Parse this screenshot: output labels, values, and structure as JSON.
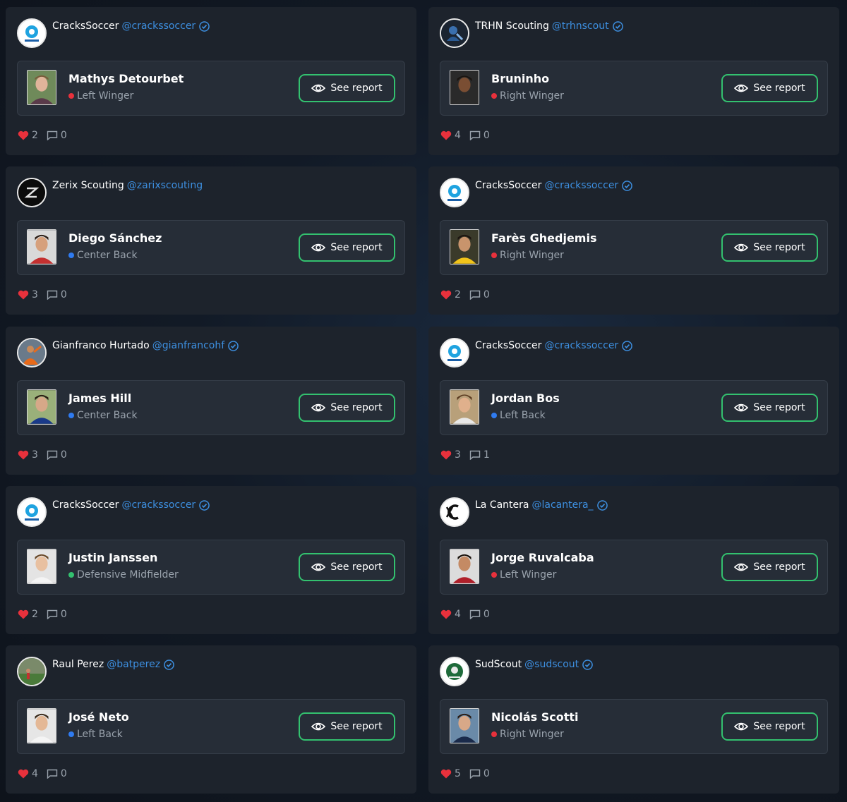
{
  "ui": {
    "see_report_label": "See report",
    "colors": {
      "card_bg": "#1d232c",
      "player_box_bg": "#262d37",
      "button_border": "#33c16f",
      "handle": "#3d8fe0",
      "verified": "#3d8fe0",
      "heart": "#e8313c",
      "pos_winger": "#e8313c",
      "pos_defender": "#2f7bf0",
      "pos_midfielder": "#33c16f"
    },
    "icons": [
      "verified-badge-icon",
      "eye-icon",
      "heart-icon",
      "comment-icon"
    ]
  },
  "cards": [
    {
      "author_name": "CracksSoccer",
      "author_handle": "@crackssoccer",
      "verified": true,
      "avatar": "crackssoccer-logo",
      "player_name": "Mathys Detourbet",
      "position": "Left Winger",
      "position_color": "#e8313c",
      "likes": "2",
      "comments": "0"
    },
    {
      "author_name": "TRHN Scouting",
      "author_handle": "@trhnscout",
      "verified": true,
      "avatar": "trhn-logo",
      "player_name": "Bruninho",
      "position": "Right Winger",
      "position_color": "#e8313c",
      "likes": "4",
      "comments": "0"
    },
    {
      "author_name": "Zerix Scouting",
      "author_handle": "@zarixscouting",
      "verified": false,
      "avatar": "zerix-logo",
      "player_name": "Diego Sánchez",
      "position": "Center Back",
      "position_color": "#2f7bf0",
      "likes": "3",
      "comments": "0"
    },
    {
      "author_name": "CracksSoccer",
      "author_handle": "@crackssoccer",
      "verified": true,
      "avatar": "crackssoccer-logo",
      "player_name": "Farès Ghedjemis",
      "position": "Right Winger",
      "position_color": "#e8313c",
      "likes": "2",
      "comments": "0"
    },
    {
      "author_name": "Gianfranco Hurtado",
      "author_handle": "@gianfrancohf",
      "verified": true,
      "avatar": "person-photo",
      "player_name": "James Hill",
      "position": "Center Back",
      "position_color": "#2f7bf0",
      "likes": "3",
      "comments": "0"
    },
    {
      "author_name": "CracksSoccer",
      "author_handle": "@crackssoccer",
      "verified": true,
      "avatar": "crackssoccer-logo",
      "player_name": "Jordan Bos",
      "position": "Left Back",
      "position_color": "#2f7bf0",
      "likes": "3",
      "comments": "1"
    },
    {
      "author_name": "CracksSoccer",
      "author_handle": "@crackssoccer",
      "verified": true,
      "avatar": "crackssoccer-logo",
      "player_name": "Justin Janssen",
      "position": "Defensive Midfielder",
      "position_color": "#33c16f",
      "likes": "2",
      "comments": "0"
    },
    {
      "author_name": "La Cantera",
      "author_handle": "@lacantera_",
      "verified": true,
      "avatar": "lacantera-logo",
      "player_name": "Jorge Ruvalcaba",
      "position": "Left Winger",
      "position_color": "#e8313c",
      "likes": "4",
      "comments": "0"
    },
    {
      "author_name": "Raul Perez",
      "author_handle": "@batperez",
      "verified": true,
      "avatar": "pitch-photo",
      "player_name": "José Neto",
      "position": "Left Back",
      "position_color": "#2f7bf0",
      "likes": "4",
      "comments": "0"
    },
    {
      "author_name": "SudScout",
      "author_handle": "@sudscout",
      "verified": true,
      "avatar": "sudscout-logo",
      "player_name": "Nicolás Scotti",
      "position": "Right Winger",
      "position_color": "#e8313c",
      "likes": "5",
      "comments": "0"
    }
  ]
}
